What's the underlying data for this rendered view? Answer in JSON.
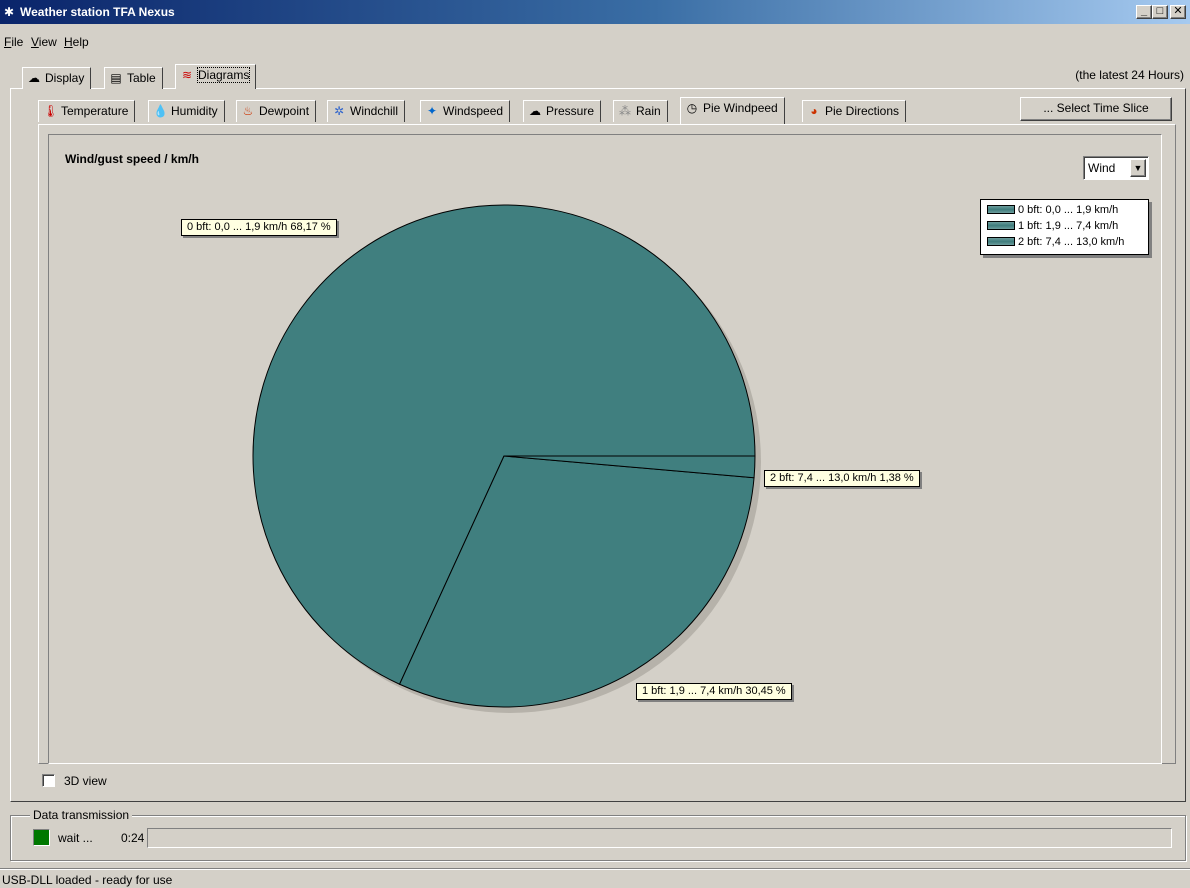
{
  "window": {
    "title": "Weather station TFA Nexus",
    "buttons": [
      "_",
      "□",
      "✕"
    ]
  },
  "menu": [
    {
      "label": "File",
      "accel": "F",
      "rest": "ile"
    },
    {
      "label": "View",
      "accel": "V",
      "rest": "iew"
    },
    {
      "label": "Help",
      "accel": "H",
      "rest": "elp"
    }
  ],
  "top_tabs": [
    {
      "label": "Display",
      "icon": "cloud-icon"
    },
    {
      "label": "Table",
      "icon": "table-icon"
    },
    {
      "label": "Diagrams",
      "icon": "chart-icon",
      "active": true
    }
  ],
  "time_range_label": "(the latest 24 Hours)",
  "diagram_tabs": [
    {
      "label": "Temperature",
      "icon": "thermometer-icon"
    },
    {
      "label": "Humidity",
      "icon": "drops-icon"
    },
    {
      "label": "Dewpoint",
      "icon": "dewpoint-icon"
    },
    {
      "label": "Windchill",
      "icon": "windchill-icon"
    },
    {
      "label": "Windspeed",
      "icon": "compass-icon"
    },
    {
      "label": "Pressure",
      "icon": "cloud-icon"
    },
    {
      "label": "Rain",
      "icon": "rain-icon"
    },
    {
      "label": "Pie Windpeed",
      "icon": "pie-icon",
      "active": true
    },
    {
      "label": "Pie Directions",
      "icon": "pie-color-icon"
    }
  ],
  "select_time_slice_label": "... Select Time Slice",
  "chart_select": {
    "value": "Wind"
  },
  "three_d_label": "3D view",
  "data_transmission": {
    "legend": "Data transmission",
    "status": "wait ...",
    "time": "0:24",
    "progress": 0
  },
  "statusbar": "USB-DLL loaded - ready for use",
  "colors": {
    "slice": "#407f7f",
    "label_bg": "#ffffe1",
    "led": "#007800"
  },
  "chart_data": {
    "type": "pie",
    "title": "Wind/gust speed / km/h",
    "labels": [
      "0 bft: 0,0 ... 1,9 km/h",
      "1 bft: 1,9 ... 7,4 km/h",
      "2 bft: 7,4 ... 13,0 km/h"
    ],
    "values": [
      68.17,
      30.45,
      1.38
    ],
    "slice_labels": [
      "0 bft: 0,0 ... 1,9 km/h 68,17 %",
      "1 bft: 1,9 ... 7,4 km/h 30,45 %",
      "2 bft: 7,4 ... 13,0 km/h 1,38 %"
    ],
    "legend": [
      "0 bft: 0,0 ... 1,9 km/h",
      "1 bft: 1,9 ... 7,4 km/h",
      "2 bft: 7,4 ... 13,0 km/h"
    ],
    "legend_position": "top-right"
  }
}
